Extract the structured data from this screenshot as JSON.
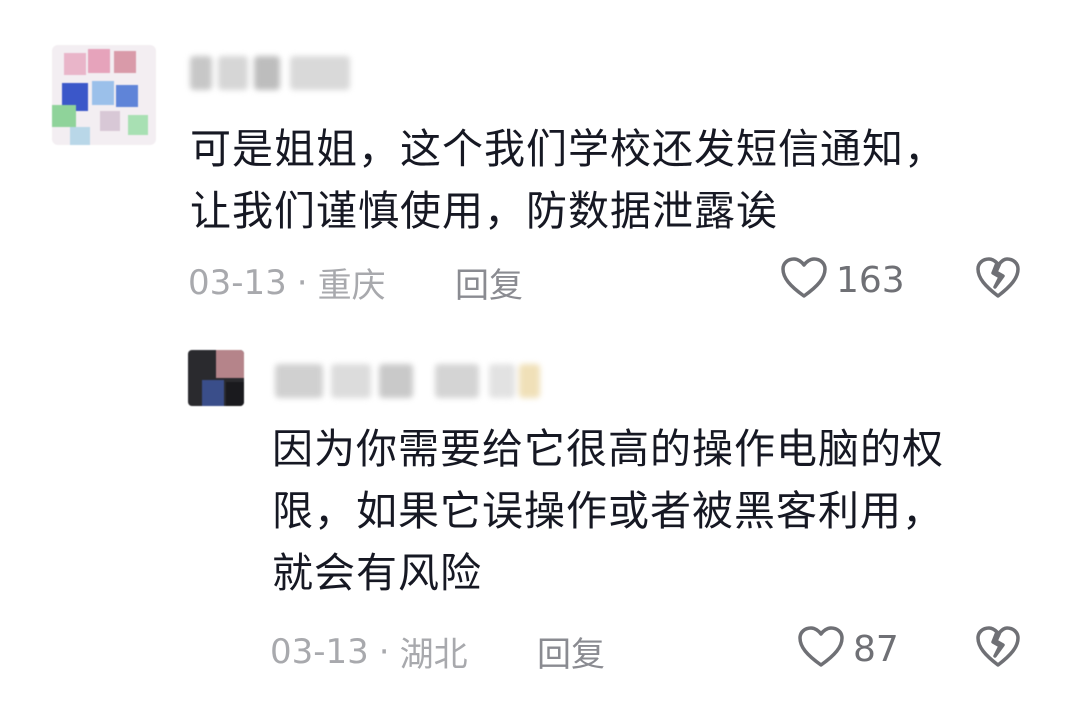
{
  "comments": [
    {
      "text_lines": [
        "可是姐姐，这个我们学校还发短信通知，",
        "让我们谨慎使用，防数据泄露诶"
      ],
      "date": "03-13",
      "location": "重庆",
      "reply_label": "回复",
      "likes": "163"
    },
    {
      "text_lines": [
        "因为你需要给它很高的操作电脑的权",
        "限，如果它误操作或者被黑客利用，",
        "就会有风险"
      ],
      "date": "03-13",
      "location": "湖北",
      "reply_label": "回复",
      "likes": "87"
    }
  ],
  "meta_separator": "·",
  "icons": {
    "like": "heart-outline-icon",
    "dislike": "broken-heart-icon"
  },
  "colors": {
    "text": "#161823",
    "meta": "#a8a9ad",
    "icon": "#6f7075"
  }
}
